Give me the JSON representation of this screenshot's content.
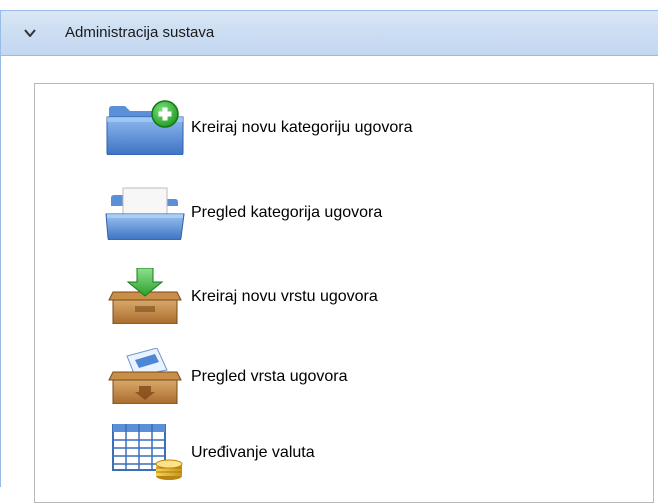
{
  "panel": {
    "title": "Administracija sustava",
    "collapse_icon": "chevron-down-icon"
  },
  "menu": [
    {
      "label": "Kreiraj novu kategoriju ugovora",
      "icon": "folder-add-icon"
    },
    {
      "label": "Pregled kategorija ugovora",
      "icon": "folder-open-icon"
    },
    {
      "label": "Kreiraj novu vrstu ugovora",
      "icon": "box-download-icon"
    },
    {
      "label": "Pregled vrsta ugovora",
      "icon": "box-view-icon"
    },
    {
      "label": "Uređivanje valuta",
      "icon": "currency-table-icon"
    }
  ],
  "colors": {
    "header_gradient_top": "#dae7f6",
    "header_gradient_bottom": "#c4d7f1",
    "border": "#99bbe8"
  }
}
